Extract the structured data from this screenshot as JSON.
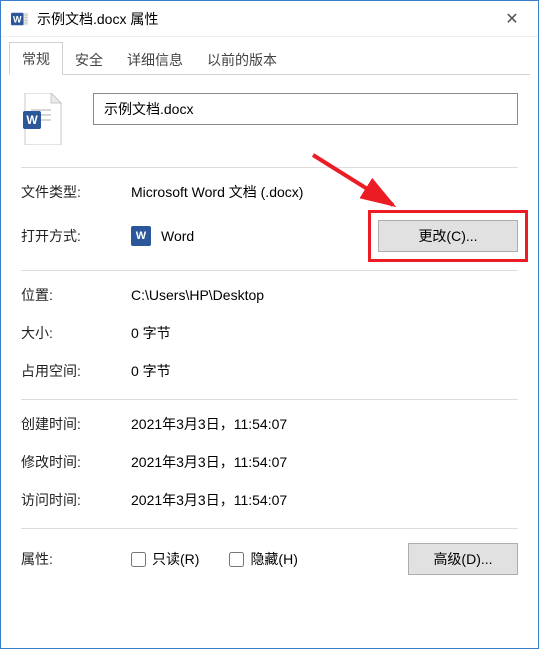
{
  "titlebar": {
    "title": "示例文档.docx 属性",
    "close": "✕"
  },
  "tabs": [
    {
      "label": "常规",
      "selected": true
    },
    {
      "label": "安全",
      "selected": false
    },
    {
      "label": "详细信息",
      "selected": false
    },
    {
      "label": "以前的版本",
      "selected": false
    }
  ],
  "file": {
    "name_value": "示例文档.docx"
  },
  "rows": {
    "file_type_label": "文件类型:",
    "file_type_value": "Microsoft Word 文档 (.docx)",
    "open_with_label": "打开方式:",
    "open_with_app": "Word",
    "change_button": "更改(C)...",
    "location_label": "位置:",
    "location_value": "C:\\Users\\HP\\Desktop",
    "size_label": "大小:",
    "size_value": "0 字节",
    "size_on_disk_label": "占用空间:",
    "size_on_disk_value": "0 字节",
    "created_label": "创建时间:",
    "created_value": "2021年3月3日，11:54:07",
    "modified_label": "修改时间:",
    "modified_value": "2021年3月3日，11:54:07",
    "accessed_label": "访问时间:",
    "accessed_value": "2021年3月3日，11:54:07",
    "attributes_label": "属性:",
    "readonly_label": "只读(R)",
    "hidden_label": "隐藏(H)",
    "advanced_button": "高级(D)..."
  },
  "icons": {
    "word": "W"
  }
}
